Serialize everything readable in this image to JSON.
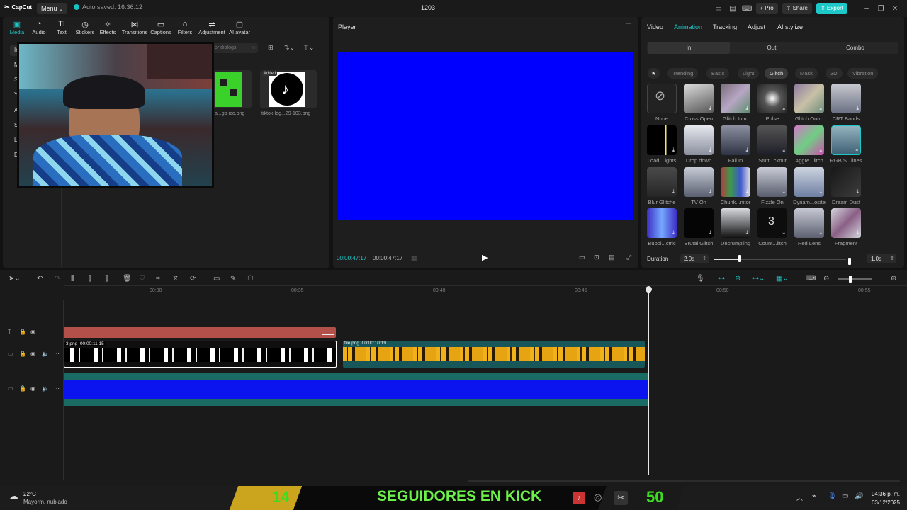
{
  "app": {
    "logo_text": "CapCut",
    "menu_label": "Menu",
    "autosave_text": "Auto saved: 16:36:12",
    "project_title": "1203",
    "pro_label": "Pro",
    "share_label": "Share",
    "export_label": "Export",
    "accent_color": "#1fc8c8"
  },
  "toolbar": {
    "tools": [
      {
        "label": "Media",
        "icon": "media-icon"
      },
      {
        "label": "Audio",
        "icon": "audio-icon"
      },
      {
        "label": "Text",
        "icon": "text-icon"
      },
      {
        "label": "Stickers",
        "icon": "stickers-icon"
      },
      {
        "label": "Effects",
        "icon": "effects-icon"
      },
      {
        "label": "Transitions",
        "icon": "transitions-icon"
      },
      {
        "label": "Captions",
        "icon": "captions-icon"
      },
      {
        "label": "Filters",
        "icon": "filters-icon"
      },
      {
        "label": "Adjustment",
        "icon": "adjustment-icon"
      },
      {
        "label": "AI avatar",
        "icon": "ai-avatar-icon"
      }
    ]
  },
  "media": {
    "sidebar": [
      "Im",
      "M",
      "Su",
      "Yo",
      "AI",
      "Sp",
      "Li",
      "De"
    ],
    "search_placeholder": "or dialogs",
    "added_badge": "Added",
    "files": [
      {
        "name": "a...go-ico.png"
      },
      {
        "name": "tiktok-log...29-103.png"
      }
    ]
  },
  "player": {
    "title": "Player",
    "current_time": "00:00:47:17",
    "total_time": "00:00:47:17"
  },
  "inspector": {
    "tabs": [
      "Video",
      "Animation",
      "Tracking",
      "Adjust",
      "AI stylize"
    ],
    "segments": [
      "In",
      "Out",
      "Combo"
    ],
    "categories": [
      "Trending",
      "Basic",
      "Light",
      "Glitch",
      "Mask",
      "3D",
      "Vibration"
    ],
    "effects": [
      "None",
      "Cross Open",
      "Glitch Intro",
      "Pulse",
      "Glitch Outro",
      "CRT Bands",
      "Loadi...ights",
      "Drop down",
      "Fall In",
      "Stutt...ckout",
      "Aggre...litch",
      "RGB S...lines",
      "Blur Glitche",
      "TV On",
      "Chunk...nitor",
      "Fizzle On",
      "Dynam...osite",
      "Dream Dust",
      "Bubbl...ctric",
      "Brutal Glitch",
      "Uncrumpling",
      "Count...litch",
      "Red Lens",
      "Fragment"
    ],
    "duration_label": "Duration",
    "duration_value": "2.0s",
    "duration_end": "1.0s"
  },
  "timeline": {
    "ruler": [
      "00:30",
      "00:35",
      "00:40",
      "00:45",
      "00:50",
      "00:55"
    ],
    "clip1_label": "3.png",
    "clip1_duration": "00:00:11:15",
    "clip2_label": "file.png",
    "clip2_duration": "00:00:10:19"
  },
  "taskbar": {
    "temperature": "22°C",
    "weather": "Mayorm. nublado",
    "overlay_left_number": "14",
    "overlay_text": "SEGUIDORES EN KICK",
    "overlay_right_number": "50",
    "time": "04:36 p. m.",
    "date": "03/12/2025"
  }
}
